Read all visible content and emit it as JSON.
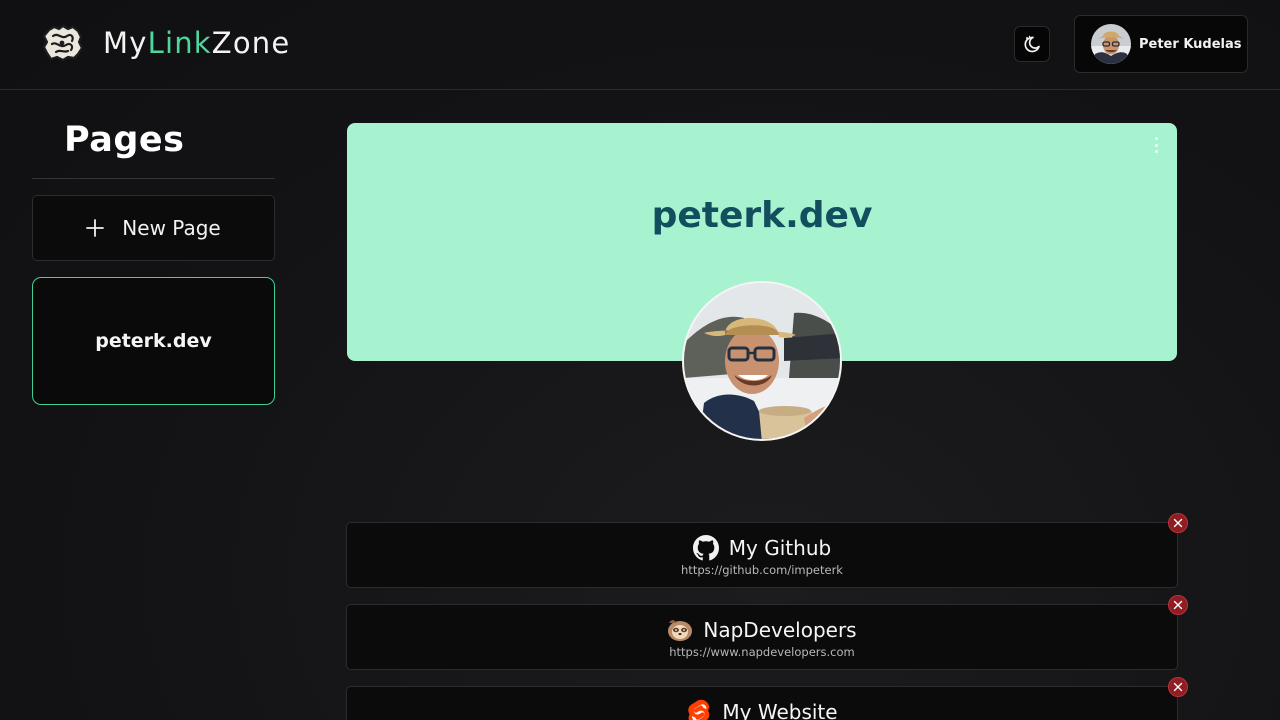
{
  "header": {
    "logo_text_prefix": "My",
    "logo_text_accent": "Link",
    "logo_text_suffix": "Zone",
    "user_name": "Peter Kudelas"
  },
  "sidebar": {
    "title": "Pages",
    "new_page_label": "New Page",
    "pages": [
      {
        "label": "peterk.dev"
      }
    ]
  },
  "main": {
    "banner_title": "peterk.dev",
    "banner_color": "#a7f3d0",
    "links": [
      {
        "title": "My Github",
        "url": "https://github.com/impeterk",
        "icon": "github-icon"
      },
      {
        "title": "NapDevelopers",
        "url": "https://www.napdevelopers.com",
        "icon": "sloth-icon"
      },
      {
        "title": "My Website",
        "url": "",
        "icon": "svelte-icon"
      }
    ]
  },
  "colors": {
    "accent": "#4fd69c",
    "page_card_border": "#3fcf97",
    "remove_button": "#8f1d24",
    "background": "#141416"
  }
}
